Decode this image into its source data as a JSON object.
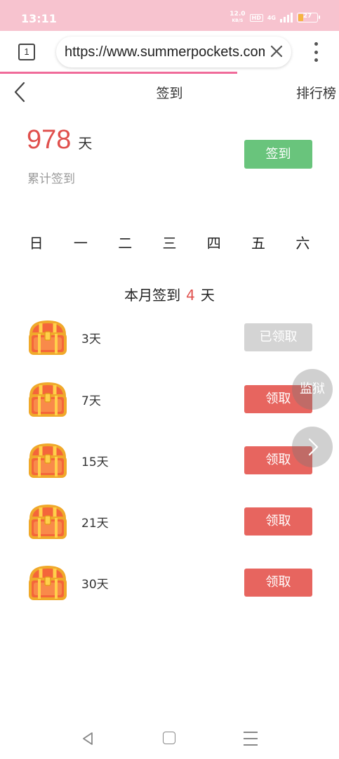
{
  "status_bar": {
    "time": "13:11",
    "net_speed_value": "12.0",
    "net_speed_unit": "KB/S",
    "hd_badge": "HD",
    "signal_label": "4G",
    "battery_level": "27"
  },
  "browser": {
    "tab_count": "1",
    "url": "https://www.summerpockets.com"
  },
  "header": {
    "title": "签到",
    "rank_link": "排行榜"
  },
  "summary": {
    "total_days": "978",
    "total_unit": "天",
    "total_label": "累计签到",
    "signin_button": "签到"
  },
  "weekdays": [
    "日",
    "一",
    "二",
    "三",
    "四",
    "五",
    "六"
  ],
  "month": {
    "prefix": "本月签到",
    "count": "4",
    "suffix": "天"
  },
  "rewards": [
    {
      "days": "3天",
      "button": "已领取",
      "claimed": true
    },
    {
      "days": "7天",
      "button": "领取",
      "claimed": false
    },
    {
      "days": "15天",
      "button": "领取",
      "claimed": false
    },
    {
      "days": "21天",
      "button": "领取",
      "claimed": false
    },
    {
      "days": "30天",
      "button": "领取",
      "claimed": false
    }
  ],
  "floating": {
    "jail_label": "监狱"
  },
  "colors": {
    "accent_red": "#e0504d",
    "signin_green": "#69c47c",
    "claim_red": "#e7655f",
    "claimed_gray": "#d4d4d4",
    "status_pink": "#f7c3cf"
  },
  "icons": {
    "back": "chevron-left-icon",
    "clear": "close-icon",
    "menu": "more-vertical-icon",
    "chest": "treasure-chest-icon",
    "next": "chevron-right-icon"
  }
}
